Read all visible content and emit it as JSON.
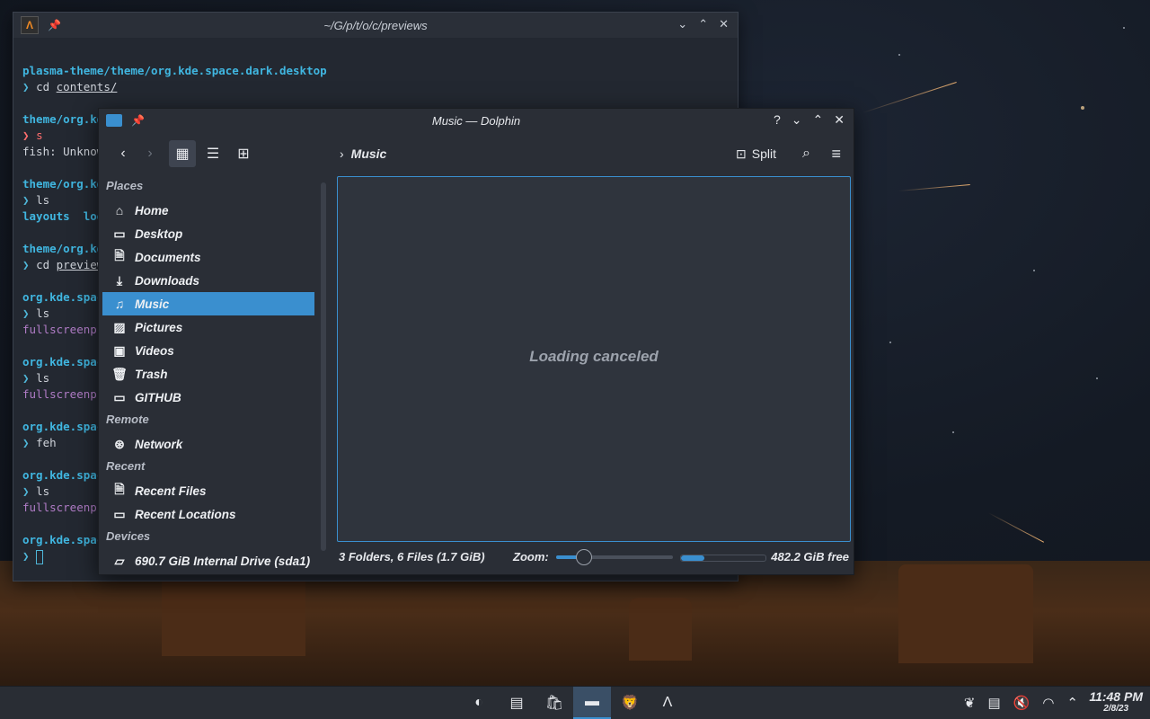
{
  "terminal": {
    "title": "~/G/p/t/o/c/previews",
    "app_icon_glyph": "Λ",
    "lines": [
      {
        "type": "path",
        "text": "plasma-theme/theme/org.kde.space.dark.desktop"
      },
      {
        "type": "cmd",
        "prompt": "❯",
        "cmd": "cd",
        "arg": "contents/"
      },
      {
        "type": "blank",
        "text": ""
      },
      {
        "type": "path",
        "text": "theme/org.kd"
      },
      {
        "type": "err",
        "prompt": "❯",
        "cmd": "s"
      },
      {
        "type": "plain",
        "text": "fish: Unknow"
      },
      {
        "type": "blank",
        "text": ""
      },
      {
        "type": "path",
        "text": "theme/org.kd"
      },
      {
        "type": "cmd",
        "prompt": "❯",
        "cmd": "ls",
        "arg": ""
      },
      {
        "type": "dirs",
        "text1": "layouts",
        "text2": "log"
      },
      {
        "type": "blank",
        "text": ""
      },
      {
        "type": "path",
        "text": "theme/org.kd"
      },
      {
        "type": "cmd",
        "prompt": "❯",
        "cmd": "cd",
        "arg": "preview"
      },
      {
        "type": "blank",
        "text": ""
      },
      {
        "type": "path",
        "text": "org.kde.spac"
      },
      {
        "type": "cmd",
        "prompt": "❯",
        "cmd": "ls",
        "arg": ""
      },
      {
        "type": "mag",
        "text": "fullscreenpr"
      },
      {
        "type": "blank",
        "text": ""
      },
      {
        "type": "path",
        "text": "org.kde.spac"
      },
      {
        "type": "cmd",
        "prompt": "❯",
        "cmd": "ls",
        "arg": ""
      },
      {
        "type": "mag",
        "text": "fullscreenpr"
      },
      {
        "type": "blank",
        "text": ""
      },
      {
        "type": "path",
        "text": "org.kde.spac"
      },
      {
        "type": "cmd",
        "prompt": "❯",
        "cmd": "feh",
        "arg": ""
      },
      {
        "type": "blank",
        "text": ""
      },
      {
        "type": "path",
        "text": "org.kde.spac"
      },
      {
        "type": "cmd",
        "prompt": "❯",
        "cmd": "ls",
        "arg": ""
      },
      {
        "type": "mag",
        "text": "fullscreenpr"
      },
      {
        "type": "blank",
        "text": ""
      },
      {
        "type": "path",
        "text": "org.kde.spac"
      },
      {
        "type": "cursor",
        "prompt": "❯"
      }
    ]
  },
  "dolphin": {
    "title": "Music — Dolphin",
    "window_buttons": [
      "?",
      "⌄",
      "⌃",
      "✕"
    ],
    "breadcrumb": "Music",
    "split_label": "Split",
    "sidebar": {
      "sections": [
        {
          "label": "Places",
          "items": [
            {
              "label": "Home",
              "icon": "home-icon",
              "glyph": "⌂"
            },
            {
              "label": "Desktop",
              "icon": "desktop-icon",
              "glyph": "▭"
            },
            {
              "label": "Documents",
              "icon": "documents-icon",
              "glyph": "🗎"
            },
            {
              "label": "Downloads",
              "icon": "downloads-icon",
              "glyph": "⤓"
            },
            {
              "label": "Music",
              "icon": "music-icon",
              "glyph": "♫",
              "selected": true
            },
            {
              "label": "Pictures",
              "icon": "pictures-icon",
              "glyph": "▨"
            },
            {
              "label": "Videos",
              "icon": "videos-icon",
              "glyph": "▣"
            },
            {
              "label": "Trash",
              "icon": "trash-icon",
              "glyph": "🗑"
            },
            {
              "label": "GITHUB",
              "icon": "folder-icon",
              "glyph": "▭"
            }
          ]
        },
        {
          "label": "Remote",
          "items": [
            {
              "label": "Network",
              "icon": "network-icon",
              "glyph": "⊛"
            }
          ]
        },
        {
          "label": "Recent",
          "items": [
            {
              "label": "Recent Files",
              "icon": "recent-files-icon",
              "glyph": "🗎"
            },
            {
              "label": "Recent Locations",
              "icon": "recent-locations-icon",
              "glyph": "▭"
            }
          ]
        },
        {
          "label": "Devices",
          "items": [
            {
              "label": "690.7 GiB Internal Drive (sda1)",
              "icon": "drive-icon",
              "glyph": "▱"
            }
          ]
        }
      ]
    },
    "view_message": "Loading canceled",
    "status": {
      "summary": "3 Folders, 6 Files (1.7 GiB)",
      "zoom_label": "Zoom:",
      "zoom_fraction": 0.23,
      "space_used_fraction": 0.28,
      "free_label": "482.2 GiB free"
    }
  },
  "taskbar": {
    "tasks": [
      {
        "name": "app-launcher-icon",
        "glyph": "◐",
        "active": false
      },
      {
        "name": "system-monitor-icon",
        "glyph": "▤",
        "active": false
      },
      {
        "name": "store-icon",
        "glyph": "🛍",
        "active": false
      },
      {
        "name": "dolphin-task-icon",
        "glyph": "▬",
        "active": true
      },
      {
        "name": "brave-browser-icon",
        "glyph": "🦁",
        "active": false
      },
      {
        "name": "terminal-task-icon",
        "glyph": "Λ",
        "active": false
      }
    ],
    "tray": [
      {
        "name": "vault-icon",
        "glyph": "❦"
      },
      {
        "name": "clipboard-icon",
        "glyph": "▤"
      },
      {
        "name": "volume-muted-icon",
        "glyph": "🔇"
      },
      {
        "name": "wifi-icon",
        "glyph": "◠"
      },
      {
        "name": "tray-expand-icon",
        "glyph": "⌃"
      }
    ],
    "clock_time": "11:48 PM",
    "clock_date": "2/8/23"
  },
  "colors": {
    "accent": "#3a8fcf",
    "terminal_path": "#40b6e0",
    "terminal_error": "#ff6e6e",
    "terminal_magenta": "#b07cc6"
  }
}
